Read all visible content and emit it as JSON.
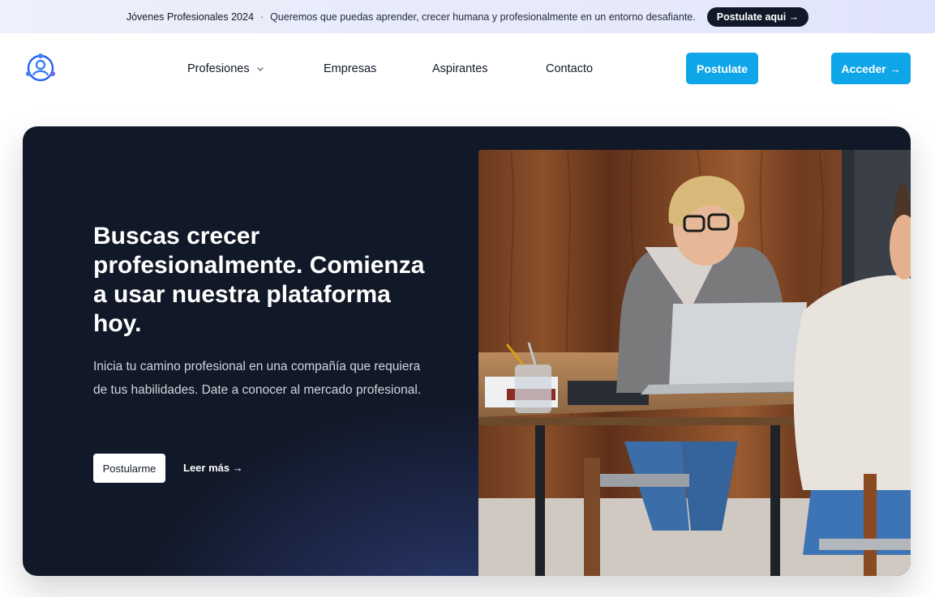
{
  "announcement": {
    "title": "Jóvenes Profesionales 2024",
    "separator": "·",
    "message": "Queremos que puedas aprender, crecer humana y profesionalmente en un entorno desafiante.",
    "cta": "Postulate aqui →"
  },
  "nav": {
    "items": [
      {
        "label": "Profesiones",
        "icon": "chevron-down-icon"
      },
      {
        "label": "Empresas"
      },
      {
        "label": "Aspirantes"
      },
      {
        "label": "Contacto"
      }
    ],
    "postulate": "Postulate",
    "login": "Acceder →",
    "logo_icon": "user-network-logo",
    "accent_color": "#0ea5e9"
  },
  "hero": {
    "title": "Buscas crecer profesionalmente. Comienza a usar nuestra plataforma hoy.",
    "text": "Inicia tu camino profesional en una compañía que requiera de tus habilidades. Date a conocer al mercado profesional.",
    "primary_button": "Postularme",
    "secondary_link": "Leer más →",
    "background_color": "#111827"
  }
}
